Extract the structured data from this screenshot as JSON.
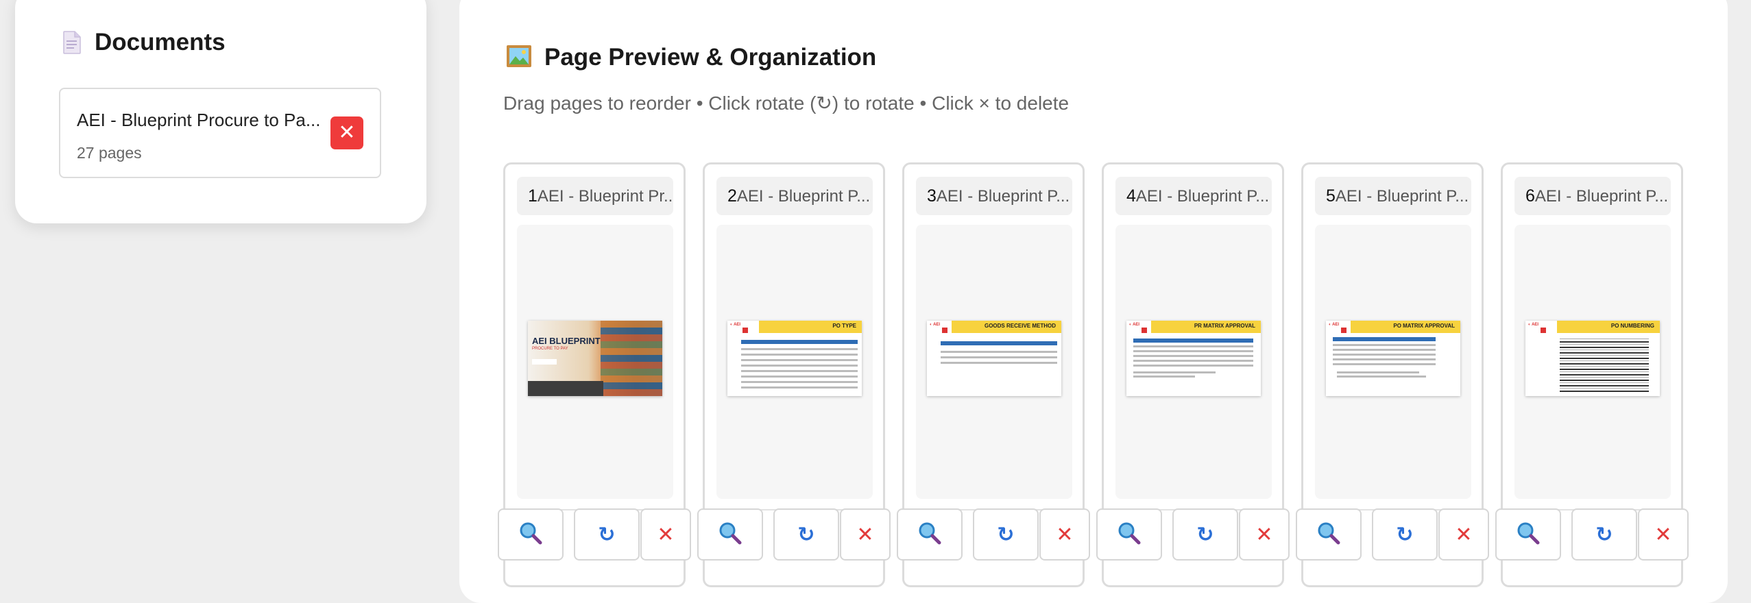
{
  "documents_panel": {
    "title": "Documents",
    "title_icon": "document-icon",
    "items": [
      {
        "name": "AEI - Blueprint Procure to Pa...",
        "pages": "27 pages",
        "remove_icon": "close-icon"
      }
    ]
  },
  "preview_panel": {
    "title": "Page Preview & Organization",
    "title_icon": "framed-picture-icon",
    "subtitle": "Drag pages to reorder • Click rotate (↻) to rotate • Click × to delete",
    "pages": [
      {
        "number": "1",
        "label": "AEI - Blueprint Pr...",
        "thumb_title": "AEI BLUEPRINT",
        "thumb_subtitle": "PROCURE TO PAY"
      },
      {
        "number": "2",
        "label": "AEI - Blueprint P...",
        "thumb_title": "PO TYPE"
      },
      {
        "number": "3",
        "label": "AEI - Blueprint P...",
        "thumb_title": "GOODS RECEIVE METHOD"
      },
      {
        "number": "4",
        "label": "AEI - Blueprint P...",
        "thumb_title": "PR MATRIX APPROVAL"
      },
      {
        "number": "5",
        "label": "AEI - Blueprint P...",
        "thumb_title": "PO MATRIX APPROVAL"
      },
      {
        "number": "6",
        "label": "AEI - Blueprint P...",
        "thumb_title": "PO NUMBERING"
      }
    ],
    "actions": {
      "zoom_icon": "magnifier-icon",
      "rotate_symbol": "↻",
      "delete_symbol": "✕"
    }
  },
  "colors": {
    "accent_red": "#ef3b3b",
    "rotate_blue": "#2b6fd6",
    "thumb_banner_yellow": "#f7d23e"
  }
}
